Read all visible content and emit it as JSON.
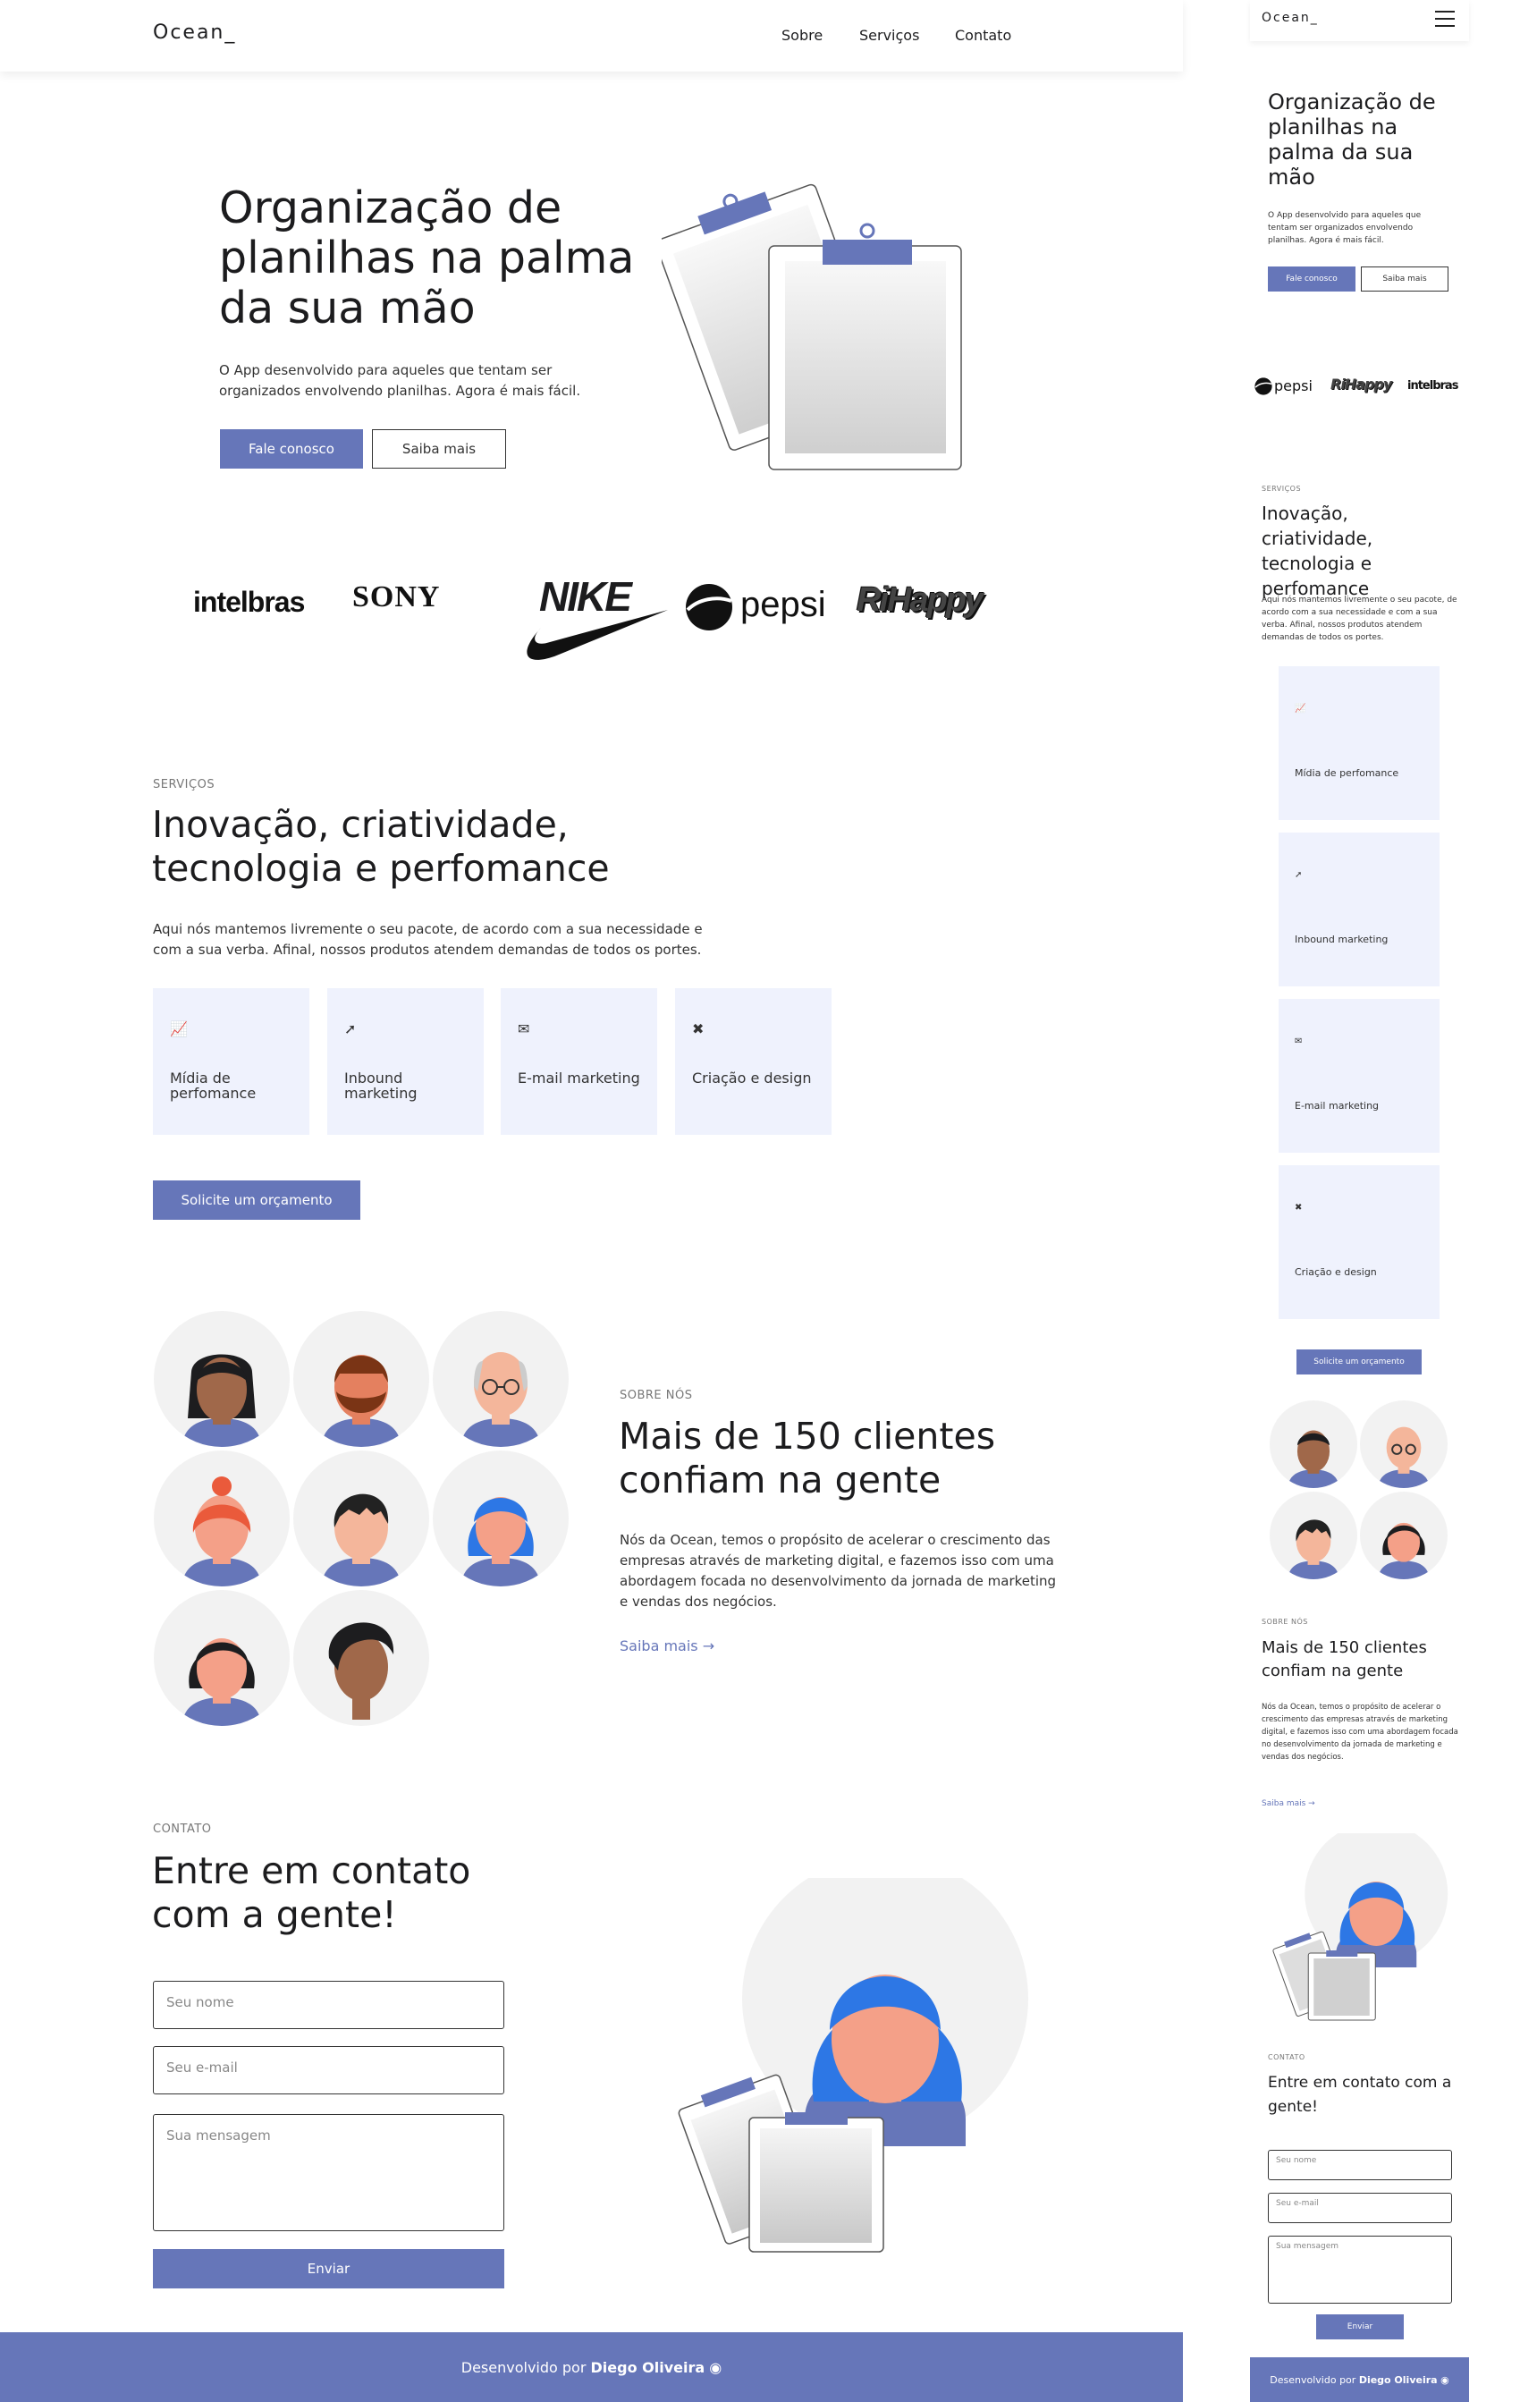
{
  "nav": {
    "logo": "Ocean_",
    "links": [
      "Sobre",
      "Serviços",
      "Contato"
    ]
  },
  "hero": {
    "title": "Organização de planilhas na palma da sua mão",
    "text": "O App desenvolvido para aqueles que tentam ser organizados envolvendo planilhas. Agora é mais fácil.",
    "primary_button": "Fale conosco",
    "secondary_button": "Saiba mais"
  },
  "brands": [
    "intelbras",
    "SONY",
    "NIKE",
    "pepsi",
    "RiHappy"
  ],
  "services": {
    "tag": "SERVIÇOS",
    "title": "Inovação, criatividade, tecnologia e perfomance",
    "text": "Aqui nós mantemos livremente o seu pacote, de acordo com a sua necessidade e com a sua verba. Afinal, nossos produtos atendem demandas de todos os portes.",
    "cards": [
      {
        "label": "Mídia de perfomance",
        "icon": "chart-icon"
      },
      {
        "label": "Inbound marketing",
        "icon": "paper-plane-icon"
      },
      {
        "label": "E-mail marketing",
        "icon": "envelope-icon"
      },
      {
        "label": "Criação e design",
        "icon": "tools-icon"
      }
    ],
    "button": "Solicite um orçamento"
  },
  "about": {
    "tag": "SOBRE NÓS",
    "title": "Mais de 150 clientes confiam na gente",
    "text": "Nós da Ocean, temos o propósito de acelerar o crescimento das empresas através de marketing digital, e fazemos isso com uma abordagem focada no desenvolvimento da jornada de marketing e vendas dos negócios.",
    "link": "Saiba mais"
  },
  "contact": {
    "tag": "CONTATO",
    "title": "Entre em contato com a gente!",
    "name_placeholder": "Seu nome",
    "email_placeholder": "Seu e-mail",
    "message_placeholder": "Sua mensagem",
    "button": "Enviar"
  },
  "footer": {
    "text": "Desenvolvido por",
    "author": "Diego Oliveira"
  },
  "colors": {
    "accent": "#6676b9",
    "card": "#eff2fd",
    "avatar_bg": "#f2f2f2"
  }
}
